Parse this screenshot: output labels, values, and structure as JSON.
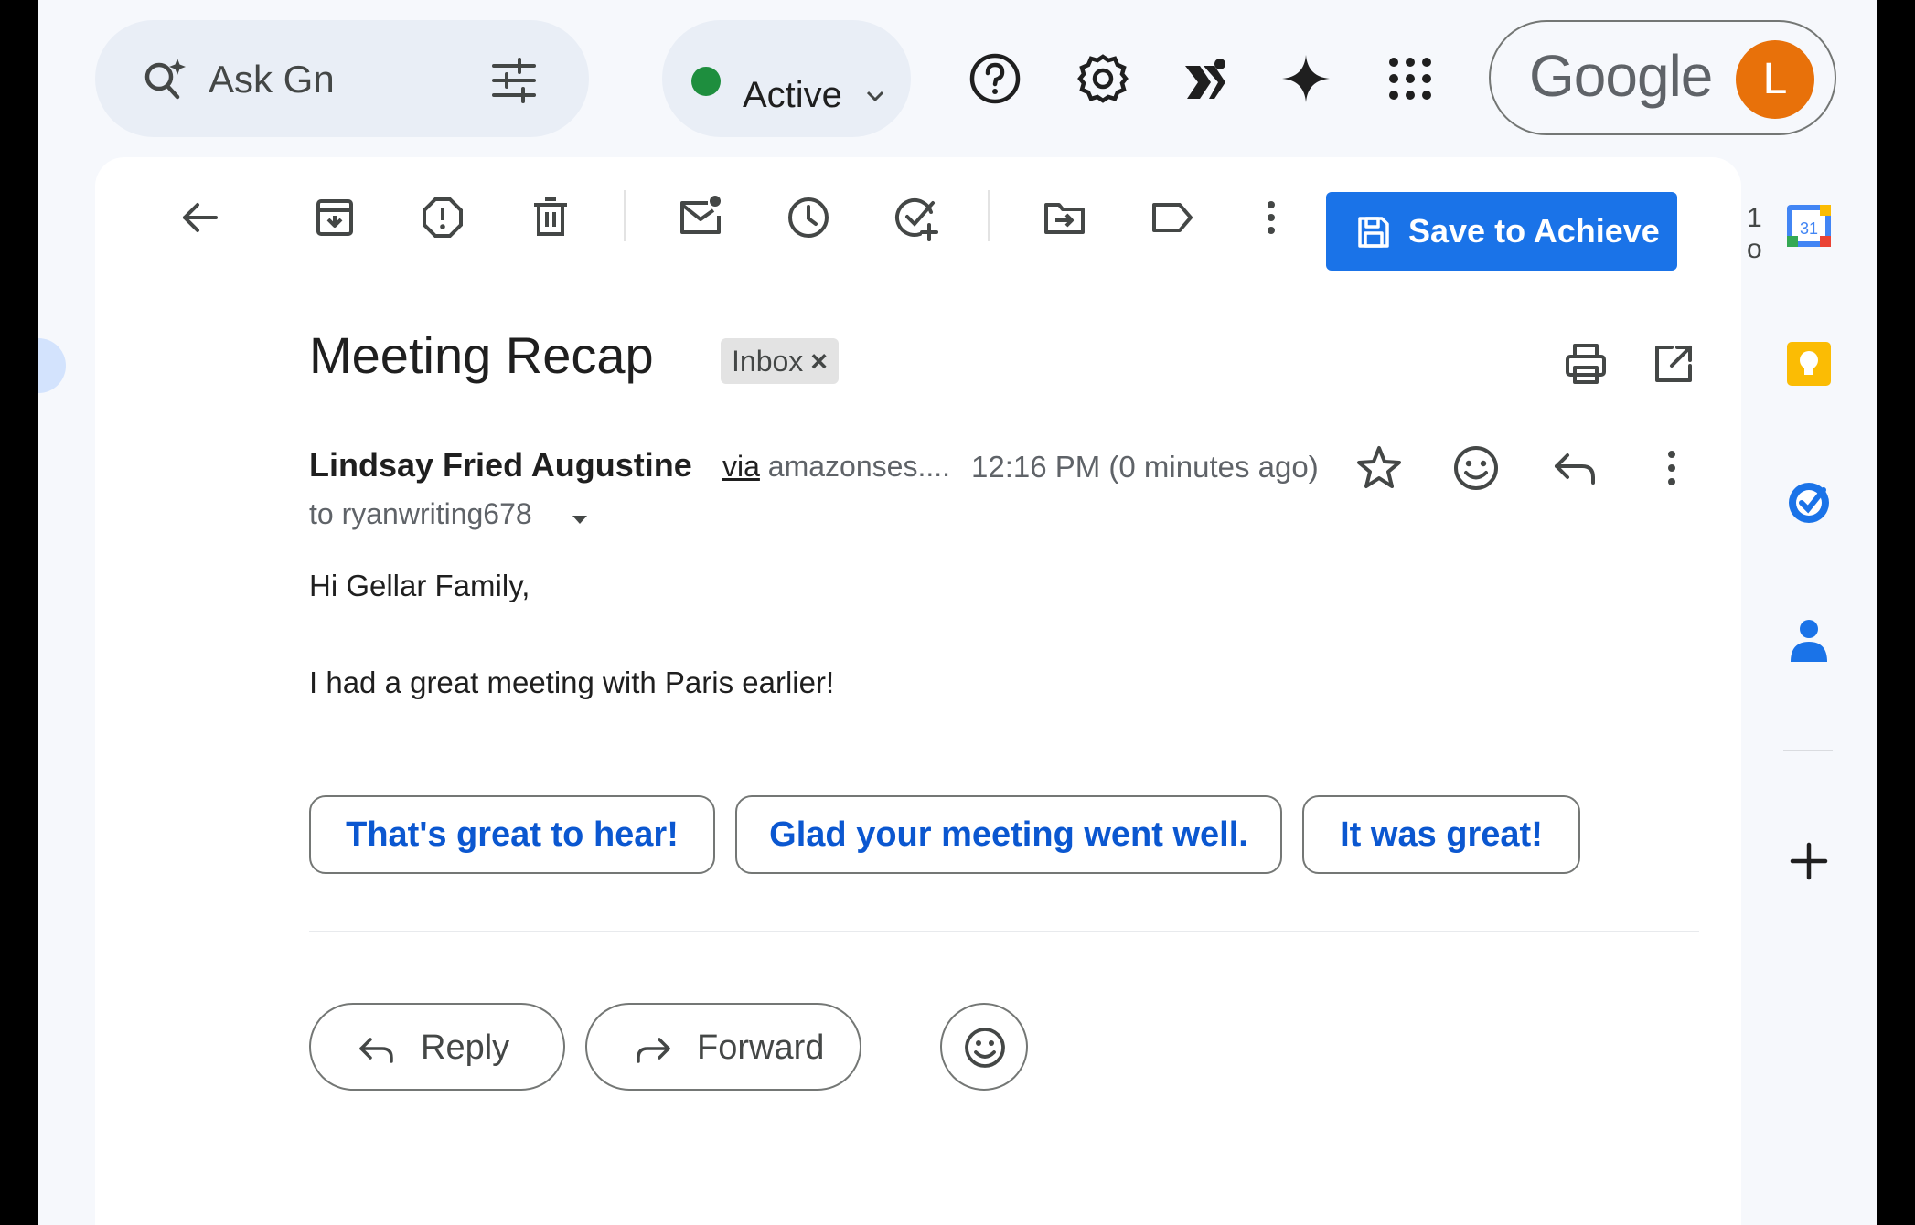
{
  "search": {
    "placeholder": "Ask Gn"
  },
  "status": {
    "label": "Active",
    "color": "#1e8e3e"
  },
  "header_icons": [
    "help-icon",
    "settings-icon",
    "extension-icon",
    "gemini-icon",
    "apps-grid-icon"
  ],
  "account": {
    "brand": "Google",
    "avatar_letter": "L",
    "avatar_color": "#e8710a"
  },
  "toolbar": {
    "save_label": "Save to Achieve",
    "counter": "1 o",
    "icons": [
      "back-arrow-icon",
      "archive-icon",
      "report-spam-icon",
      "delete-icon",
      "mark-unread-icon",
      "snooze-icon",
      "add-to-tasks-icon",
      "move-to-icon",
      "label-icon",
      "more-vert-icon"
    ]
  },
  "email": {
    "subject": "Meeting Recap",
    "label_chip": "Inbox",
    "chip_close": "×",
    "sender_name": "Lindsay Fried Augustine",
    "via_word": "via",
    "via_domain": "amazonses....",
    "time": "12:16 PM (0 minutes ago)",
    "recipient": "to ryanwriting678",
    "body": [
      "Hi Gellar Family,",
      "I had a great meeting with Paris earlier!"
    ]
  },
  "smart_replies": [
    "That's great to hear!",
    "Glad your meeting went well.",
    "It was great!"
  ],
  "actions": {
    "reply": "Reply",
    "forward": "Forward"
  },
  "side_panel": {
    "calendar_day": "31",
    "apps": [
      "calendar-icon",
      "keep-icon",
      "tasks-icon",
      "contacts-icon",
      "add-addon-icon"
    ],
    "brand_colors": {
      "calendar_blue": "#4285f4",
      "keep_yellow": "#fbbc04",
      "tasks_blue": "#1a73e8",
      "contacts_blue": "#1a73e8"
    }
  },
  "colors": {
    "primary": "#1a73e8",
    "smart_reply_text": "#0b57d0",
    "background": "#f6f8fc"
  }
}
